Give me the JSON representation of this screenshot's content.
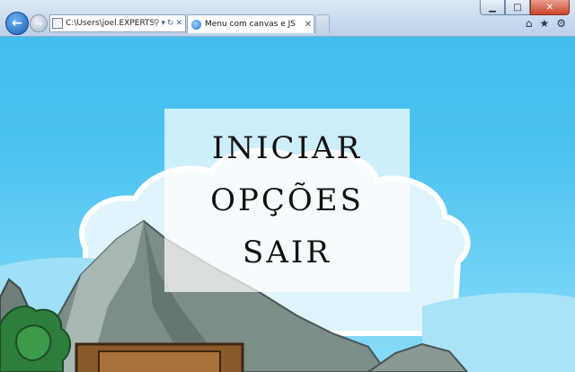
{
  "browser": {
    "address": "C:\\Users\\joel.EXPERTSIP",
    "tab_title": "Menu com canvas e JS",
    "window_buttons": {
      "minimize": "▁",
      "maximize": "□",
      "close": "✕"
    }
  },
  "menu": {
    "items": [
      {
        "label": "INICIAR"
      },
      {
        "label": "OPÇÕES"
      },
      {
        "label": "SAIR"
      }
    ]
  },
  "colors": {
    "sky": "#43bdee",
    "menu_panel": "#ffffffb8",
    "mountain": "#7a8c8a",
    "tree": "#2f7d3b",
    "crate": "#8a5a2b"
  },
  "icons": {
    "back": "back-arrow-icon",
    "forward": "forward-arrow-icon",
    "search": "search-icon",
    "refresh": "refresh-icon",
    "stop": "close-icon",
    "home": "home-icon",
    "favorites": "star-icon",
    "tools": "gear-icon"
  }
}
